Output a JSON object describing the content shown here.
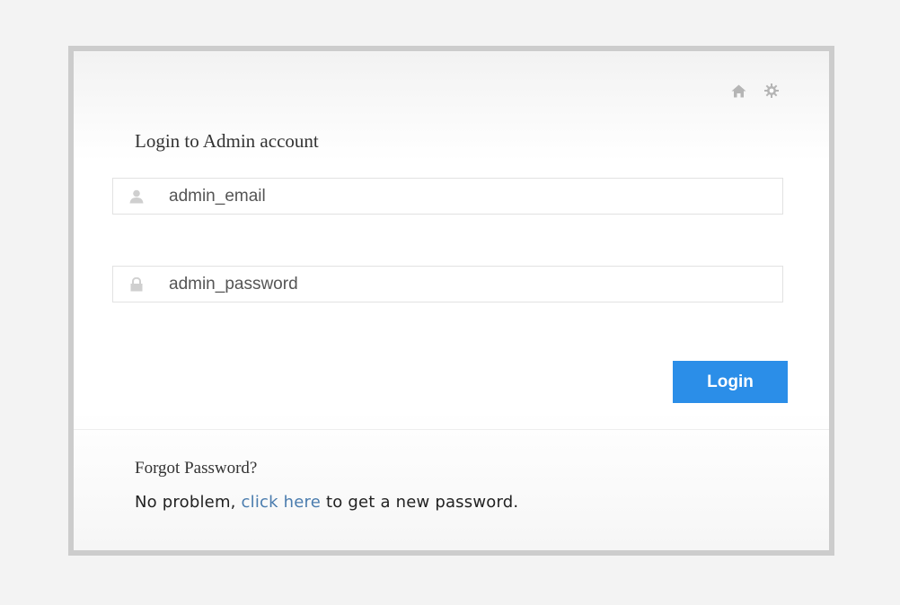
{
  "login": {
    "title": "Login to Admin account",
    "top_icons": [
      "home-icon",
      "gear-icon"
    ],
    "email_field": {
      "placeholder": "admin_email",
      "value": "",
      "icon": "user-icon"
    },
    "password_field": {
      "placeholder": "admin_password",
      "value": "",
      "icon": "lock-icon"
    },
    "login_button": "Login"
  },
  "forgot": {
    "title": "Forgot Password?",
    "text_before": "No problem, ",
    "link_text": "click here",
    "text_after": " to get a new password."
  },
  "colors": {
    "accent": "#2b8ee8",
    "link": "#4a7cae",
    "border": "#cccccc"
  }
}
